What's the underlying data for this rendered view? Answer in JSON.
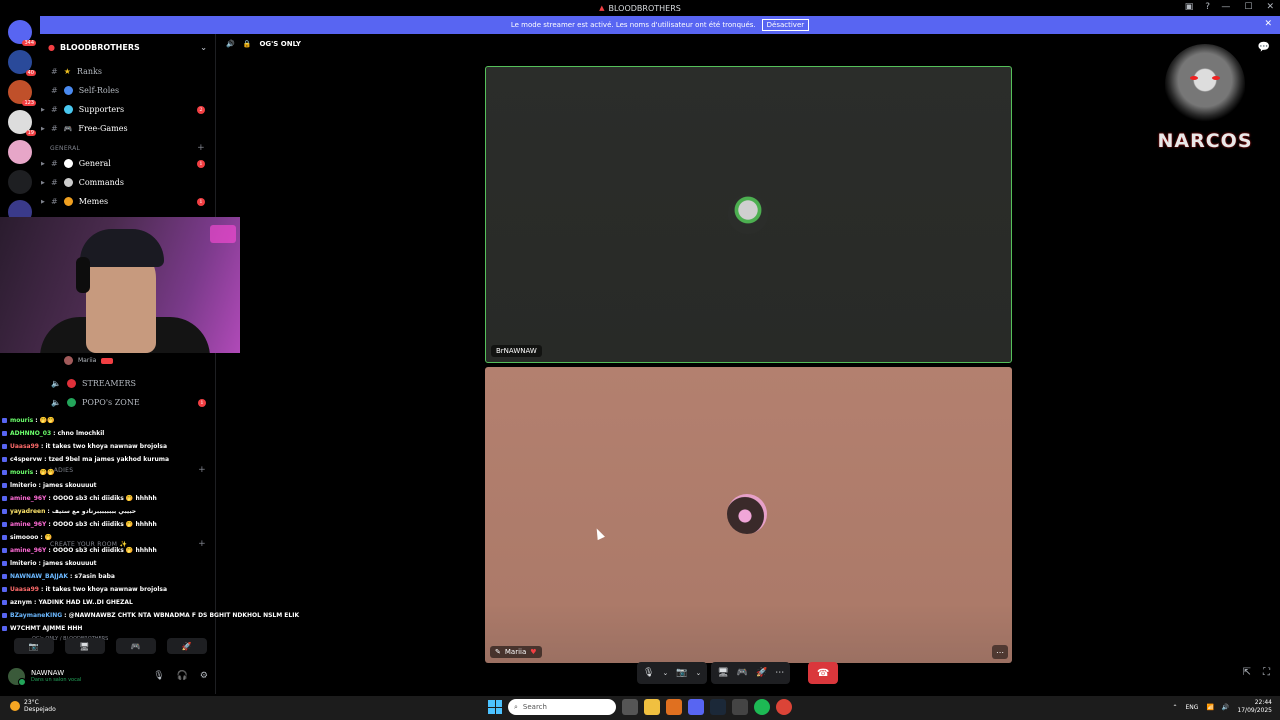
{
  "window": {
    "title": "BLOODBROTHERS"
  },
  "banner": {
    "message": "Le mode streamer est activé. Les noms d'utilisateur ont été tronqués.",
    "button": "Désactiver"
  },
  "server_rail": {
    "badges": [
      "344",
      "40",
      "123",
      "19",
      "468",
      "54"
    ]
  },
  "guild": {
    "name": "BLOODBROTHERS"
  },
  "channels_top": [
    {
      "name": "Ranks",
      "badge": ""
    },
    {
      "name": "Self-Roles",
      "badge": ""
    },
    {
      "name": "Supporters",
      "badge": "2"
    },
    {
      "name": "Free-Games",
      "badge": ""
    }
  ],
  "categories": {
    "general": "GENERAL",
    "ladies": "LADIES",
    "create_room": "CREATE YOUR ROOM ✨"
  },
  "channels_general": [
    {
      "name": "General",
      "badge": "1"
    },
    {
      "name": "Commands",
      "badge": ""
    },
    {
      "name": "Memes",
      "badge": "1"
    }
  ],
  "voice_member": {
    "name": "Mariia",
    "tag": "ㅤㅤ"
  },
  "channels_voice": [
    {
      "name": "STREAMERS",
      "badge": ""
    },
    {
      "name": "POPO's ZONE",
      "badge": "1"
    }
  ],
  "chat_lines": [
    {
      "user": "mouris",
      "color": "#6bff6b",
      "text": ": 🤭🤭"
    },
    {
      "user": "ADHNNO_03",
      "color": "#6bff6b",
      "text": ": chno lmochkil"
    },
    {
      "user": "Uaasa99",
      "color": "#ff6b6b",
      "text": ": it takes two khoya nawnaw brojolsa"
    },
    {
      "user": "c4spervw",
      "color": "#ffffff",
      "text": ": tzed 9bel ma james yakhod kuruma"
    },
    {
      "user": "mouris",
      "color": "#6bff6b",
      "text": ": 🤭🤭"
    },
    {
      "user": "lmiterio",
      "color": "#ffffff",
      "text": ": james skouuuut"
    },
    {
      "user": "amine_96Y",
      "color": "#ff6bd6",
      "text": ": OOOO sb3 chi diidiks 🤭 hhhhh"
    },
    {
      "user": "yayadreen",
      "color": "#ffe66b",
      "text": ": حبيبي ببببببببرنادو مع ستيف"
    },
    {
      "user": "amine_96Y",
      "color": "#ff6bd6",
      "text": ": OOOO sb3 chi diidiks 🤭 hhhhh"
    },
    {
      "user": "simoooo",
      "color": "#ffffff",
      "text": ": 🤭"
    },
    {
      "user": "amine_96Y",
      "color": "#ff6bd6",
      "text": ": OOOO sb3 chi diidiks 🤭 hhhhh"
    },
    {
      "user": "lmiterio",
      "color": "#ffffff",
      "text": ": james skouuuut"
    },
    {
      "user": "NAWNAW_BAJJAK",
      "color": "#6bb8ff",
      "text": ": s7asin baba"
    },
    {
      "user": "Uaasa99",
      "color": "#ff6b6b",
      "text": ": it takes two khoya nawnaw brojolsa"
    },
    {
      "user": "aznym",
      "color": "#ffffff",
      "text": ": YADINK HAD LW..DI GHEZAL"
    },
    {
      "user": "BZaymaneKING",
      "color": "#6bb8ff",
      "text": ": @NAWNAWBZ CHTK NTA WBNADMA F DS BGHIT NDKHOL NSLM ELIK"
    },
    {
      "user": "W7CHMT AJMME HHH",
      "color": "#ffffff",
      "text": ""
    }
  ],
  "voice_status": {
    "channel": "OG's ONLY / BLOODBROTHERS"
  },
  "quick_buttons": [
    "📷",
    "🖥",
    "🎮",
    "🚀"
  ],
  "user": {
    "name": "NAWNAW",
    "status": "Dans un salon vocal"
  },
  "channel_header": {
    "name": "OG'S ONLY"
  },
  "tiles": [
    {
      "name": "BrNAWNAW"
    },
    {
      "name": "Mariia"
    }
  ],
  "logo": {
    "text": "NARCOS"
  },
  "taskbar": {
    "temp": "23°C",
    "weather": "Despejado",
    "search_placeholder": "Search",
    "lang": "ENG",
    "time": "22:44",
    "date": "17/09/2025"
  },
  "colors": {
    "accent": "#5865f2",
    "speaking": "#55c05a",
    "danger": "#da373c"
  }
}
